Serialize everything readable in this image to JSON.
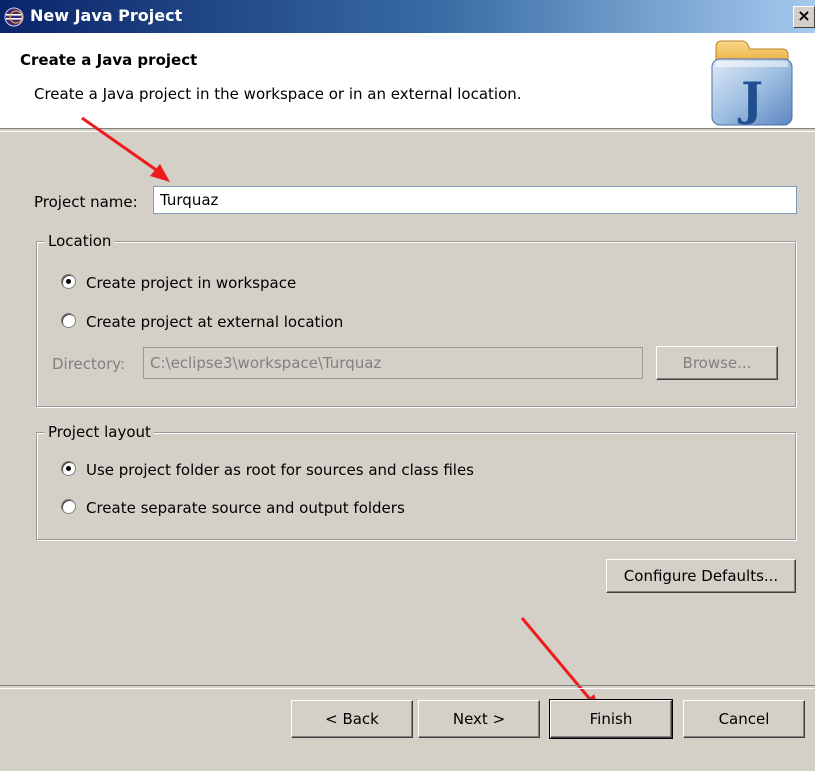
{
  "window": {
    "title": "New Java Project",
    "close_glyph": "×"
  },
  "banner": {
    "title": "Create a Java project",
    "description": "Create a Java project in the workspace or in an external location.",
    "image_icon": "java-project-wizard-icon",
    "image_letter": "J"
  },
  "project_name": {
    "label": "Project name:",
    "value": "Turquaz"
  },
  "location": {
    "legend": "Location",
    "options": [
      {
        "label": "Create project in workspace",
        "checked": true
      },
      {
        "label": "Create project at external location",
        "checked": false
      }
    ],
    "directory_label": "Directory:",
    "directory_value": "C:\\eclipse3\\workspace\\Turquaz",
    "browse_label": "Browse..."
  },
  "project_layout": {
    "legend": "Project layout",
    "options": [
      {
        "label": "Use project folder as root for sources and class files",
        "checked": true
      },
      {
        "label": "Create separate source and output folders",
        "checked": false
      }
    ]
  },
  "configure_defaults_label": "Configure Defaults...",
  "footer": {
    "back_label": "< Back",
    "next_label": "Next >",
    "finish_label": "Finish",
    "cancel_label": "Cancel"
  },
  "annotation_color": "#ee1c1c"
}
